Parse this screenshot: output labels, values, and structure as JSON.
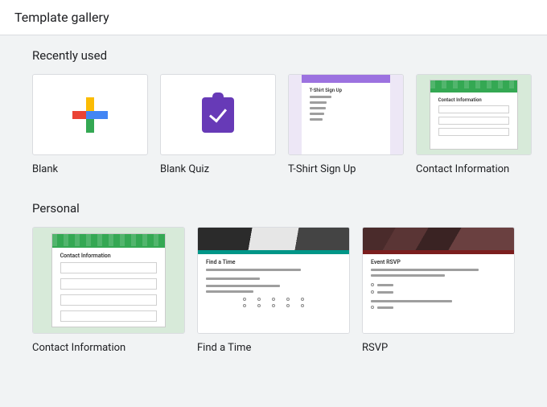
{
  "header": {
    "title": "Template gallery"
  },
  "sections": {
    "recent": {
      "title": "Recently used",
      "items": [
        {
          "label": "Blank"
        },
        {
          "label": "Blank Quiz"
        },
        {
          "label": "T-Shirt Sign Up",
          "preview_title": "T-Shirt Sign Up"
        },
        {
          "label": "Contact Information",
          "preview_title": "Contact Information"
        }
      ]
    },
    "personal": {
      "title": "Personal",
      "items": [
        {
          "label": "Contact Information",
          "preview_title": "Contact Information"
        },
        {
          "label": "Find a Time",
          "preview_title": "Find a Time"
        },
        {
          "label": "RSVP",
          "preview_title": "Event RSVP"
        }
      ]
    }
  }
}
